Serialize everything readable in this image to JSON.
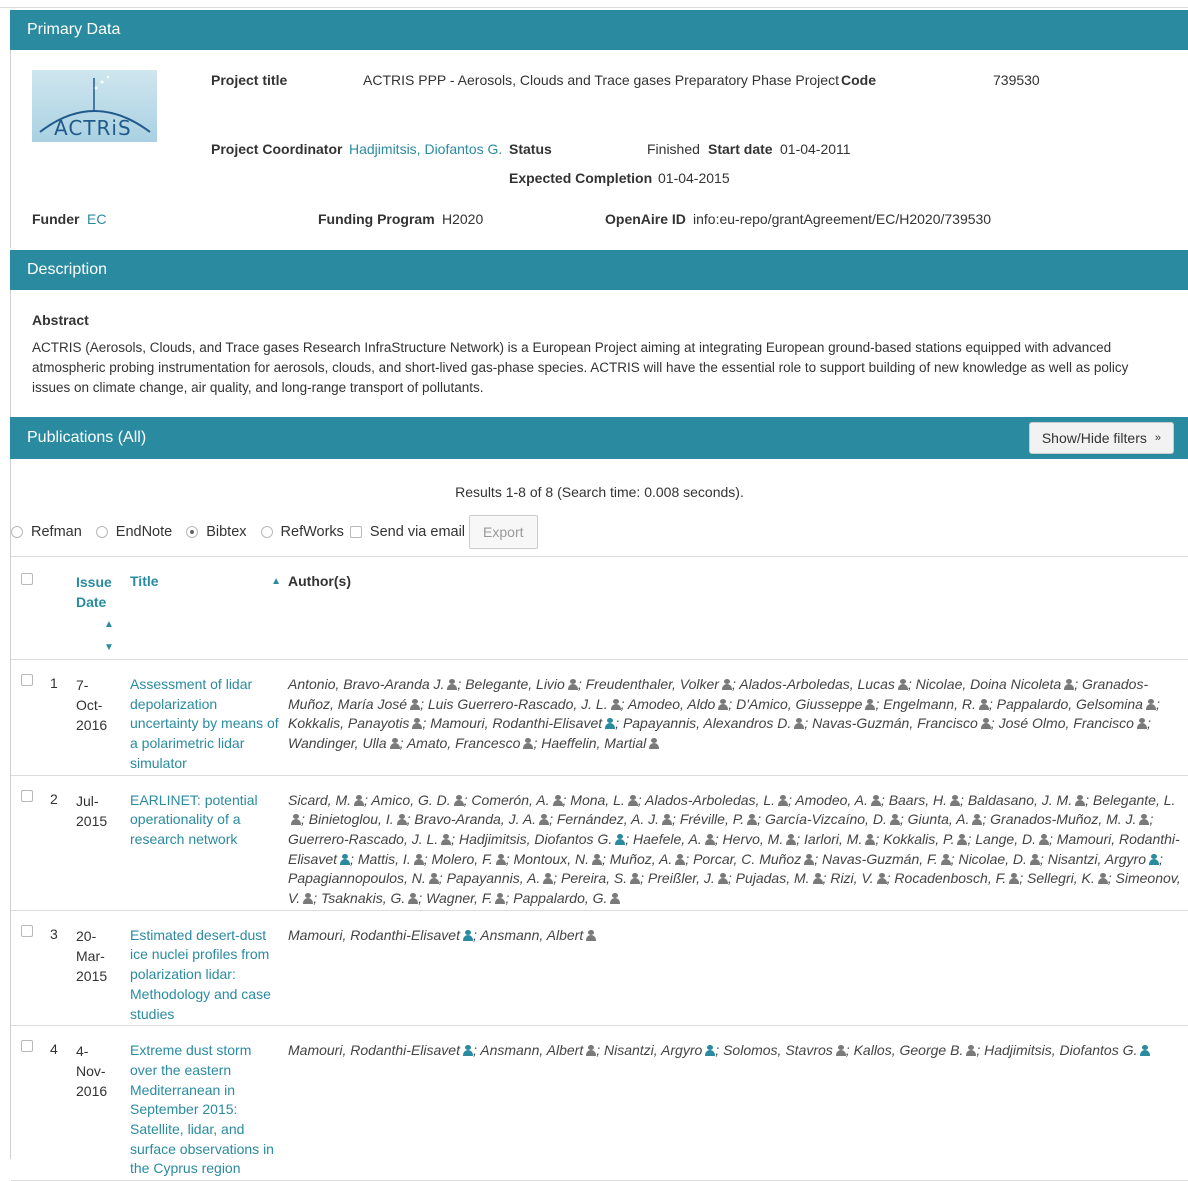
{
  "primary": {
    "heading": "Primary Data",
    "logo_text": "ACTRiS",
    "project_title_label": "Project title",
    "project_title": "ACTRIS PPP - Aerosols, Clouds and Trace gases Preparatory Phase Project",
    "code_label": "Code",
    "code": "739530",
    "coordinator_label": "Project Coordinator",
    "coordinator": "Hadjimitsis, Diofantos G.",
    "status_label": "Status",
    "status": "Finished",
    "start_label": "Start date",
    "start": "01-04-2011",
    "completion_label": "Expected Completion",
    "completion": "01-04-2015",
    "funder_label": "Funder",
    "funder": "EC",
    "program_label": "Funding Program",
    "program": "H2020",
    "openaire_label": "OpenAire ID",
    "openaire": "info:eu-repo/grantAgreement/EC/H2020/739530"
  },
  "description": {
    "heading": "Description",
    "abstract_title": "Abstract",
    "abstract": "ACTRIS (Aerosols, Clouds, and Trace gases Research InfraStructure Network) is a European Project aiming at integrating European ground-based stations equipped with advanced atmospheric probing instrumentation for aerosols, clouds, and short-lived gas-phase species. ACTRIS will have the essential role to support building of new knowledge as well as policy issues on climate change, air quality, and long-range transport of pollutants."
  },
  "publications": {
    "heading": "Publications (All)",
    "filters_button": "Show/Hide filters",
    "results": "Results 1-8 of 8 (Search time: 0.008 seconds).",
    "formats": [
      "Refman",
      "EndNote",
      "Bibtex",
      "RefWorks"
    ],
    "selected_format": "Bibtex",
    "send_email": "Send via email",
    "export": "Export",
    "columns": {
      "issue_date": "Issue Date",
      "title": "Title",
      "authors": "Author(s)"
    },
    "rows": [
      {
        "num": "1",
        "date": "7-Oct-2016",
        "title": "Assessment of lidar depolarization uncertainty by means of a polarimetric lidar simulator",
        "authors": [
          {
            "name": "Antonio, Bravo-Aranda J.",
            "icon": "grey"
          },
          {
            "name": "Belegante, Livio",
            "icon": "grey"
          },
          {
            "name": "Freudenthaler, Volker",
            "icon": "grey"
          },
          {
            "name": "Alados-Arboledas, Lucas",
            "icon": "grey"
          },
          {
            "name": "Nicolae, Doina Nicoleta",
            "icon": "grey"
          },
          {
            "name": "Granados-Muñoz, María José",
            "icon": "grey"
          },
          {
            "name": "Luis Guerrero-Rascado, J. L.",
            "icon": "grey"
          },
          {
            "name": "Amodeo, Aldo",
            "icon": "grey"
          },
          {
            "name": "D'Amico, Giusseppe",
            "icon": "grey"
          },
          {
            "name": "Engelmann, R.",
            "icon": "grey"
          },
          {
            "name": "Pappalardo, Gelsomina",
            "icon": "grey"
          },
          {
            "name": "Kokkalis, Panayotis",
            "icon": "grey"
          },
          {
            "name": "Mamouri, Rodanthi-Elisavet",
            "icon": "blue"
          },
          {
            "name": "Papayannis, Alexandros D.",
            "icon": "grey"
          },
          {
            "name": "Navas-Guzmán, Francisco",
            "icon": "grey"
          },
          {
            "name": "José Olmo, Francisco",
            "icon": "grey"
          },
          {
            "name": "Wandinger, Ulla",
            "icon": "grey"
          },
          {
            "name": "Amato, Francesco",
            "icon": "grey"
          },
          {
            "name": "Haeffelin, Martial",
            "icon": "grey"
          }
        ]
      },
      {
        "num": "2",
        "date": "Jul-2015",
        "title": "EARLINET: potential operationality of a research network",
        "authors": [
          {
            "name": "Sicard, M.",
            "icon": "grey"
          },
          {
            "name": "Amico, G. D.",
            "icon": "grey"
          },
          {
            "name": "Comerón, A.",
            "icon": "grey"
          },
          {
            "name": "Mona, L.",
            "icon": "grey"
          },
          {
            "name": "Alados-Arboledas, L.",
            "icon": "grey"
          },
          {
            "name": "Amodeo, A.",
            "icon": "grey"
          },
          {
            "name": "Baars, H.",
            "icon": "grey"
          },
          {
            "name": "Baldasano, J. M.",
            "icon": "grey"
          },
          {
            "name": "Belegante, L.",
            "icon": "grey"
          },
          {
            "name": "Binietoglou, I.",
            "icon": "grey"
          },
          {
            "name": "Bravo-Aranda, J. A.",
            "icon": "grey"
          },
          {
            "name": "Fernández, A. J.",
            "icon": "grey"
          },
          {
            "name": "Fréville, P.",
            "icon": "grey"
          },
          {
            "name": "García-Vizcaíno, D.",
            "icon": "grey"
          },
          {
            "name": "Giunta, A.",
            "icon": "grey"
          },
          {
            "name": "Granados-Muñoz, M. J.",
            "icon": "grey"
          },
          {
            "name": "Guerrero-Rascado, J. L.",
            "icon": "grey"
          },
          {
            "name": "Hadjimitsis, Diofantos G.",
            "icon": "blue"
          },
          {
            "name": "Haefele, A.",
            "icon": "grey"
          },
          {
            "name": "Hervo, M.",
            "icon": "grey"
          },
          {
            "name": "Iarlori, M.",
            "icon": "grey"
          },
          {
            "name": "Kokkalis, P.",
            "icon": "grey"
          },
          {
            "name": "Lange, D.",
            "icon": "grey"
          },
          {
            "name": "Mamouri, Rodanthi-Elisavet",
            "icon": "blue"
          },
          {
            "name": "Mattis, I.",
            "icon": "grey"
          },
          {
            "name": "Molero, F.",
            "icon": "grey"
          },
          {
            "name": "Montoux, N.",
            "icon": "grey"
          },
          {
            "name": "Muñoz, A.",
            "icon": "grey"
          },
          {
            "name": "Porcar, C. Muñoz",
            "icon": "grey"
          },
          {
            "name": "Navas-Guzmán, F.",
            "icon": "grey"
          },
          {
            "name": "Nicolae, D.",
            "icon": "grey"
          },
          {
            "name": "Nisantzi, Argyro",
            "icon": "blue"
          },
          {
            "name": "Papagiannopoulos, N.",
            "icon": "grey"
          },
          {
            "name": "Papayannis, A.",
            "icon": "grey"
          },
          {
            "name": "Pereira, S.",
            "icon": "grey"
          },
          {
            "name": "Preißler, J.",
            "icon": "grey"
          },
          {
            "name": "Pujadas, M.",
            "icon": "grey"
          },
          {
            "name": "Rizi, V.",
            "icon": "grey"
          },
          {
            "name": "Rocadenbosch, F.",
            "icon": "grey"
          },
          {
            "name": "Sellegri, K.",
            "icon": "grey"
          },
          {
            "name": "Simeonov, V.",
            "icon": "grey"
          },
          {
            "name": "Tsaknakis, G.",
            "icon": "grey"
          },
          {
            "name": "Wagner, F.",
            "icon": "grey"
          },
          {
            "name": "Pappalardo, G.",
            "icon": "grey"
          }
        ]
      },
      {
        "num": "3",
        "date": "20-Mar-2015",
        "title": "Estimated desert-dust ice nuclei profiles from polarization lidar: Methodology and case studies",
        "authors": [
          {
            "name": "Mamouri, Rodanthi-Elisavet",
            "icon": "blue"
          },
          {
            "name": "Ansmann, Albert",
            "icon": "grey"
          }
        ]
      },
      {
        "num": "4",
        "date": "4-Nov-2016",
        "title": "Extreme dust storm over the eastern Mediterranean in September 2015: Satellite, lidar, and surface observations in the Cyprus region",
        "authors": [
          {
            "name": "Mamouri, Rodanthi-Elisavet",
            "icon": "blue"
          },
          {
            "name": "Ansmann, Albert",
            "icon": "grey"
          },
          {
            "name": "Nisantzi, Argyro",
            "icon": "blue"
          },
          {
            "name": "Solomos, Stavros",
            "icon": "grey"
          },
          {
            "name": "Kallos, George B.",
            "icon": "grey"
          },
          {
            "name": "Hadjimitsis, Diofantos G.",
            "icon": "blue"
          }
        ]
      }
    ]
  }
}
